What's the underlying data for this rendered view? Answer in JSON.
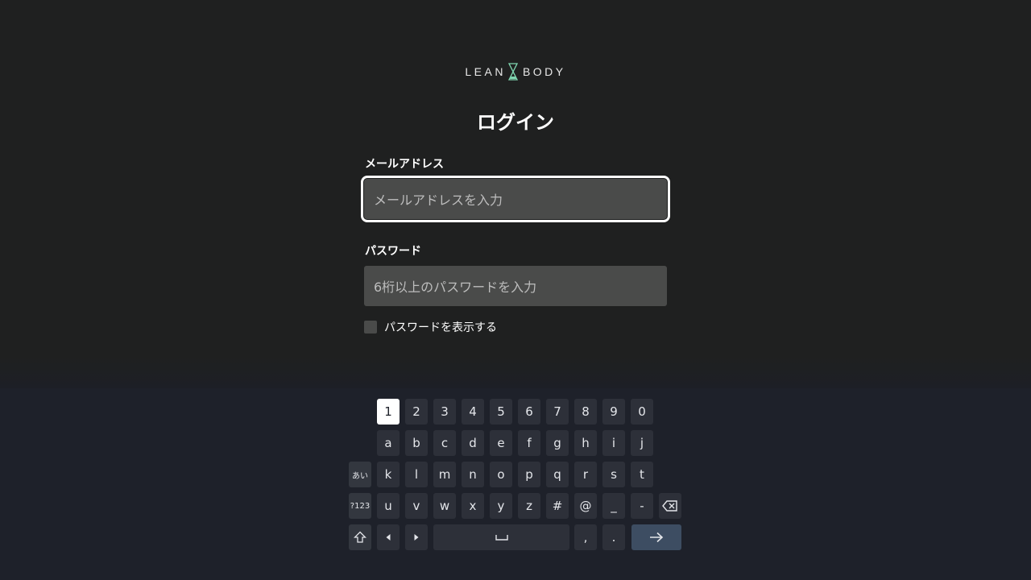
{
  "logo": {
    "left": "LEAN",
    "right": "BODY",
    "accent_color": "#7fd6b0"
  },
  "title": "ログイン",
  "email": {
    "label": "メールアドレス",
    "placeholder": "メールアドレスを入力"
  },
  "password": {
    "label": "パスワード",
    "placeholder": "6桁以上のパスワードを入力"
  },
  "show_password": {
    "label": "パスワードを表示する",
    "checked": false
  },
  "keyboard": {
    "digits": [
      "1",
      "2",
      "3",
      "4",
      "5",
      "6",
      "7",
      "8",
      "9",
      "0"
    ],
    "row_a_j": [
      "a",
      "b",
      "c",
      "d",
      "e",
      "f",
      "g",
      "h",
      "i",
      "j"
    ],
    "kana_key": "あい",
    "row_k_t": [
      "k",
      "l",
      "m",
      "n",
      "o",
      "p",
      "q",
      "r",
      "s",
      "t"
    ],
    "symbols_key": "?123",
    "row_u_dash": [
      "u",
      "v",
      "w",
      "x",
      "y",
      "z",
      "#",
      "@",
      "_",
      "-"
    ],
    "comma": ",",
    "period": ".",
    "active_key": "1"
  }
}
